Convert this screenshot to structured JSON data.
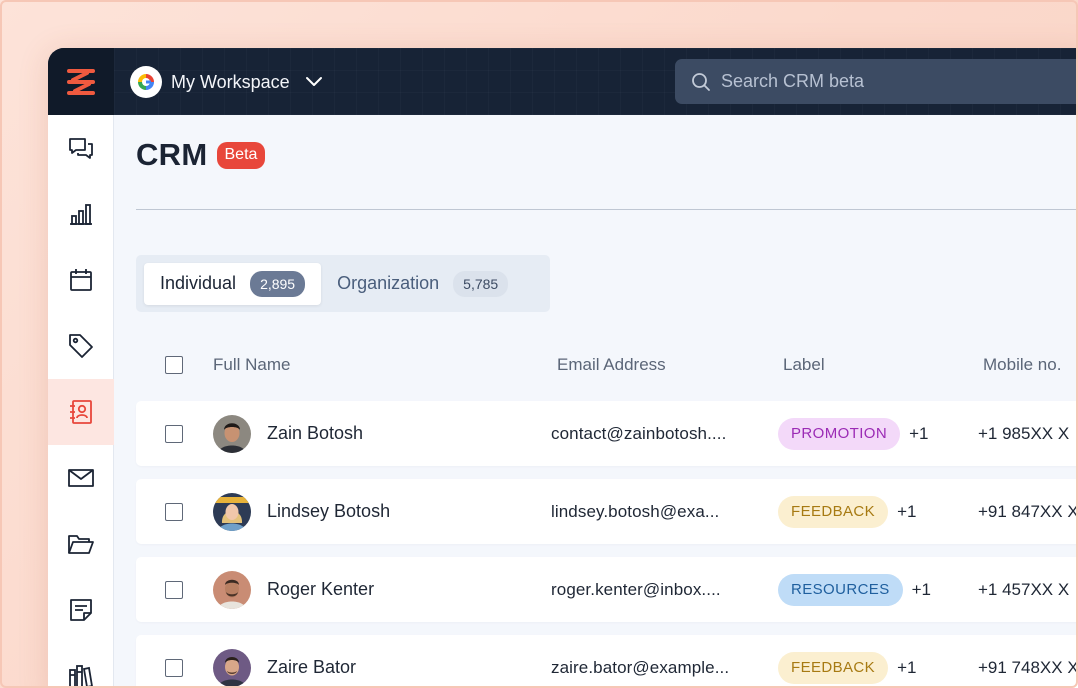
{
  "workspace": {
    "name": "My Workspace"
  },
  "search": {
    "placeholder": "Search CRM beta"
  },
  "sidebar": {
    "items": [
      {
        "icon": "chat-icon"
      },
      {
        "icon": "bar-chart-icon"
      },
      {
        "icon": "calendar-icon"
      },
      {
        "icon": "tag-icon"
      },
      {
        "icon": "contacts-icon",
        "active": true
      },
      {
        "icon": "mail-icon"
      },
      {
        "icon": "folder-icon"
      },
      {
        "icon": "notes-icon"
      },
      {
        "icon": "books-icon"
      }
    ]
  },
  "page": {
    "title": "CRM",
    "badge": "Beta"
  },
  "tabs": [
    {
      "label": "Individual",
      "count": "2,895",
      "active": true
    },
    {
      "label": "Organization",
      "count": "5,785",
      "active": false
    }
  ],
  "table": {
    "columns": [
      "Full Name",
      "Email Address",
      "Label",
      "Mobile no."
    ],
    "rows": [
      {
        "name": "Zain Botosh",
        "email": "contact@zainbotosh....",
        "label": "PROMOTION",
        "extra": "+1",
        "mobile": "+1 985XX X"
      },
      {
        "name": "Lindsey Botosh",
        "email": "lindsey.botosh@exa...",
        "label": "FEEDBACK",
        "extra": "+1",
        "mobile": "+91 847XX X"
      },
      {
        "name": "Roger Kenter",
        "email": "roger.kenter@inbox....",
        "label": "RESOURCES",
        "extra": "+1",
        "mobile": "+1 457XX X"
      },
      {
        "name": "Zaire Bator",
        "email": "zaire.bator@example...",
        "label": "FEEDBACK",
        "extra": "+1",
        "mobile": "+91 748XX X"
      }
    ]
  },
  "colors": {
    "accent": "#e8473b",
    "promotion_bg": "#f3d9f9",
    "promotion_fg": "#9b2bb5",
    "feedback_bg": "#fbefd0",
    "feedback_fg": "#a77a12",
    "resources_bg": "#bfdcf7",
    "resources_fg": "#1f5f9e"
  }
}
